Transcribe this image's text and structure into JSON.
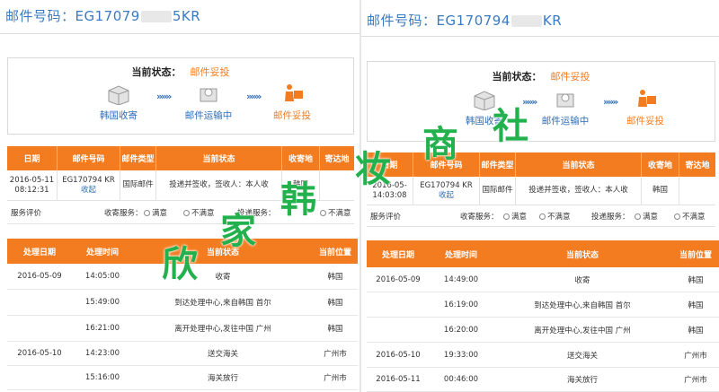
{
  "left": {
    "mail_label": "邮件号码：",
    "mail_prefix": "EG17079",
    "mail_suffix": "5KR",
    "status_label": "当前状态：",
    "status_value": "邮件妥投",
    "steps": [
      "韩国收寄",
      "邮件运输中",
      "邮件妥投"
    ],
    "arrows": "»»»",
    "table_headers": [
      "日期",
      "邮件号码",
      "邮件类型",
      "当前状态",
      "收寄地",
      "寄达地"
    ],
    "row": {
      "date": "2016-05-11 08:12:31",
      "number": "EG170794 KR",
      "collapse": "收起",
      "type": "国际邮件",
      "status": "投递并签收，签收人：本人收",
      "origin": "韩国",
      "dest": ""
    },
    "service": {
      "label": "服务评价",
      "collect_label": "收寄服务：",
      "deliver_label": "投递服务：",
      "satisfied": "满意",
      "unsatisfied": "不满意"
    },
    "log_headers": [
      "处理日期",
      "处理时间",
      "当前状态",
      "当前位置"
    ],
    "logs": [
      {
        "date": "2016-05-09",
        "time": "14:05:00",
        "status": "收寄",
        "place": "韩国"
      },
      {
        "date": "",
        "time": "15:49:00",
        "status": "到达处理中心,来自韩国 首尔",
        "place": "韩国"
      },
      {
        "date": "",
        "time": "16:21:00",
        "status": "离开处理中心,发往中国 广州",
        "place": "韩国"
      },
      {
        "date": "2016-05-10",
        "time": "14:23:00",
        "status": "送交海关",
        "place": "广州市"
      },
      {
        "date": "",
        "time": "15:16:00",
        "status": "海关放行",
        "place": "广州市"
      }
    ]
  },
  "right": {
    "mail_label": "邮件号码：",
    "mail_prefix": "EG170794",
    "mail_suffix": "KR",
    "status_label": "当前状态：",
    "status_value": "邮件妥投",
    "steps": [
      "韩国收寄",
      "邮件运输中",
      "邮件妥投"
    ],
    "arrows": "»»»",
    "table_headers": [
      "日期",
      "邮件号码",
      "邮件类型",
      "当前状态",
      "收寄地",
      "寄达地"
    ],
    "row": {
      "date": "2016-05- 14:03:08",
      "number": "EG170794 KR",
      "collapse": "收起",
      "type": "国际邮件",
      "status": "投递并签收，签收人：本人收",
      "origin": "韩国",
      "dest": ""
    },
    "service": {
      "label": "服务评价",
      "collect_label": "收寄服务：",
      "deliver_label": "投递服务：",
      "satisfied": "满意",
      "unsatisfied": "不满意"
    },
    "log_headers": [
      "处理日期",
      "处理时间",
      "当前状态",
      "当前位置"
    ],
    "logs": [
      {
        "date": "2016-05-09",
        "time": "14:49:00",
        "status": "收寄",
        "place": "韩国"
      },
      {
        "date": "",
        "time": "16:19:00",
        "status": "到达处理中心,来自韩国 首尔",
        "place": "韩国"
      },
      {
        "date": "",
        "time": "16:20:00",
        "status": "离开处理中心,发往中国 广州",
        "place": "韩国"
      },
      {
        "date": "2016-05-10",
        "time": "19:33:00",
        "status": "送交海关",
        "place": "广州市"
      },
      {
        "date": "2016-05-11",
        "time": "00:46:00",
        "status": "海关放行",
        "place": "广州市"
      }
    ]
  },
  "watermark": [
    "欣",
    "家",
    "韩",
    "妆",
    "商",
    "社"
  ],
  "colors": {
    "accent": "#f47c20",
    "link": "#2f6db5",
    "watermark": "#22b14c"
  }
}
